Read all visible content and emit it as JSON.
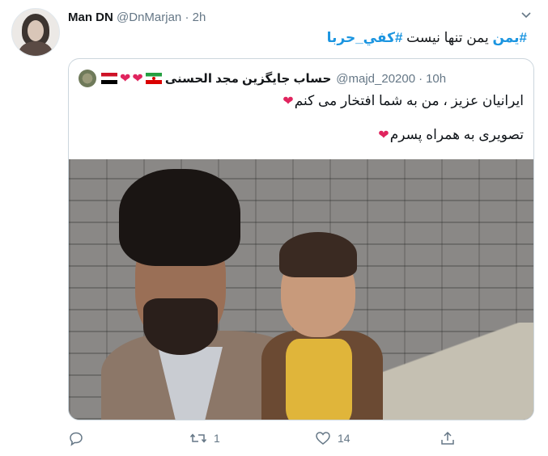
{
  "user": {
    "name": "Man DN",
    "handle": "@DnMarjan",
    "separator": "·",
    "time": "2h"
  },
  "tweet": {
    "text_prefix": "یمن تنها نیست ",
    "hashtag1": "#یمن",
    "hashtag2": "#كفي_حربا"
  },
  "quoted": {
    "display_name": "حساب جایگزین مجد الحسنی",
    "handle": "@majd_20200",
    "separator": "·",
    "time": "10h",
    "line1": "ایرانیان عزیز ، من به شما افتخار می کنم",
    "line2": "تصویری به همراه پسرم",
    "heart": "❤",
    "flags": [
      "yemen-flag",
      "iran-flag"
    ]
  },
  "actions": {
    "reply_count": "",
    "retweet_count": "1",
    "like_count": "14",
    "share_count": ""
  },
  "colors": {
    "link": "#1b95e0",
    "secondary": "#657786",
    "heart": "#e0245e",
    "border": "#ccd6dd"
  }
}
